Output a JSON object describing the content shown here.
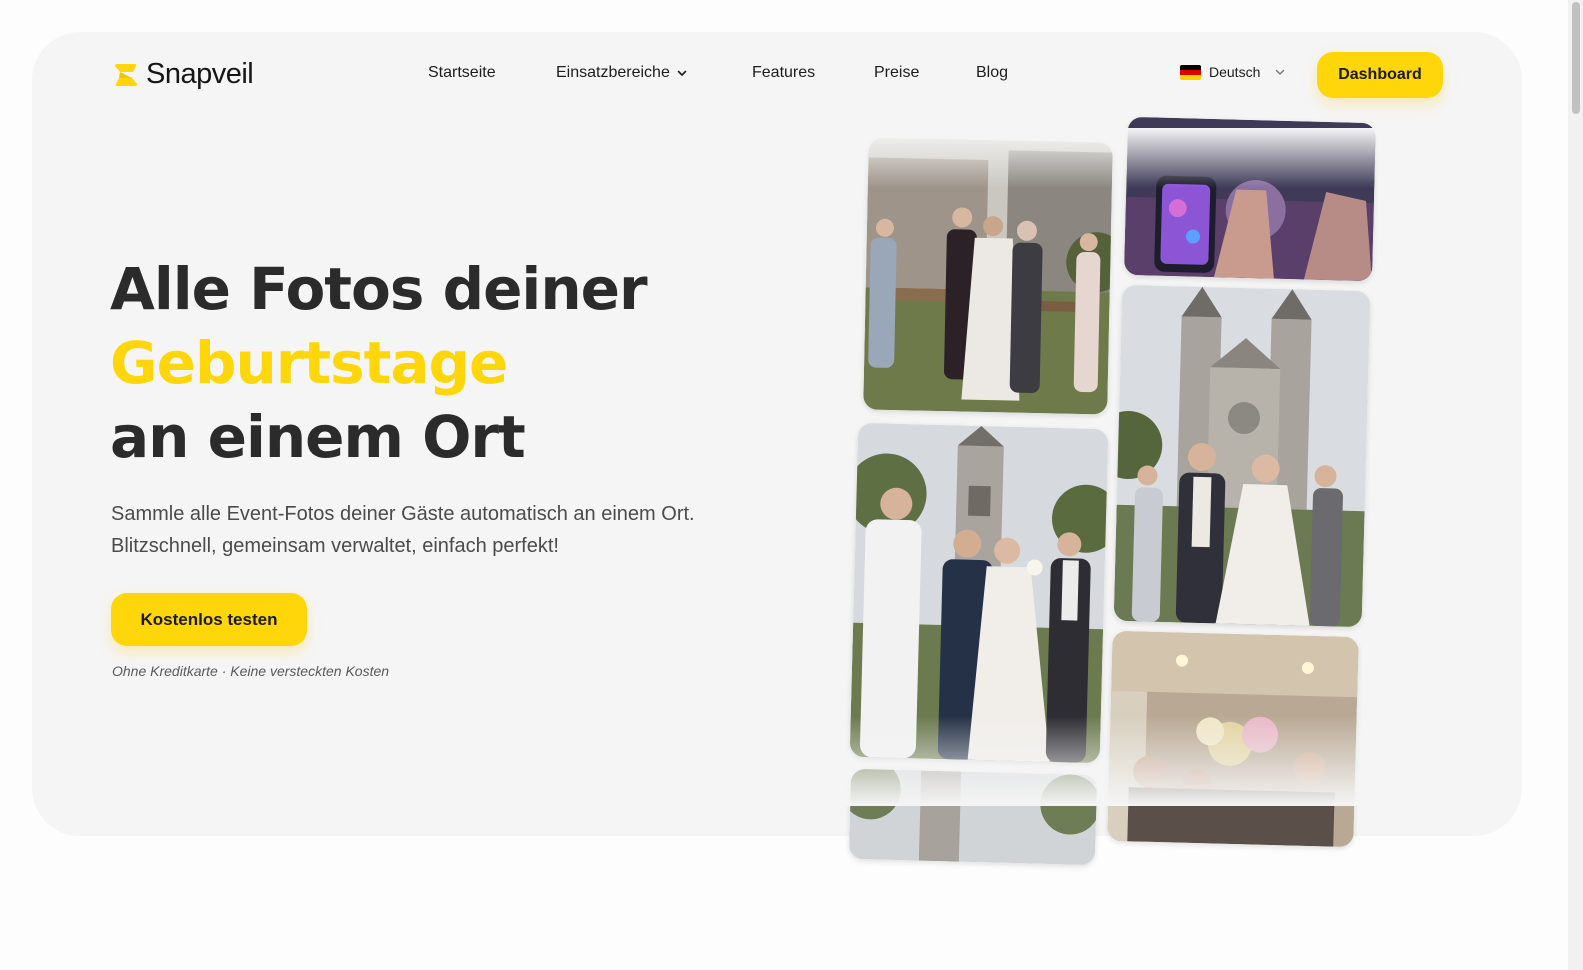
{
  "brand": {
    "name": "Snapveil",
    "color": "#ffd60a",
    "text_color": "#161616"
  },
  "nav": {
    "items": [
      {
        "label": "Startseite",
        "has_dropdown": false
      },
      {
        "label": "Einsatzbereiche",
        "has_dropdown": true
      },
      {
        "label": "Features",
        "has_dropdown": false
      },
      {
        "label": "Preise",
        "has_dropdown": false
      },
      {
        "label": "Blog",
        "has_dropdown": false
      }
    ],
    "language": {
      "label": "Deutsch",
      "flag_icon": "flag-de-icon"
    },
    "dashboard_label": "Dashboard"
  },
  "hero": {
    "headline_line1": "Alle Fotos deiner",
    "headline_accent": "Geburtstage",
    "headline_line3": "an einem Ort",
    "subtitle_line1": "Sammle alle Event-Fotos deiner Gäste automatisch an einem Ort.",
    "subtitle_line2": "Blitzschnell, gemeinsam verwaltet, einfach perfekt!",
    "cta_label": "Kostenlos testen",
    "note": "Ohne Kreditkarte · Keine versteckten Kosten"
  },
  "collage": {
    "photos": [
      {
        "name": "photo-wedding-group-garden",
        "subject": "wedding couple with guests in garden"
      },
      {
        "name": "photo-party-phone-hands",
        "subject": "hands holding phone at party"
      },
      {
        "name": "photo-wedding-church-couple",
        "subject": "laughing wedding couple in front of church"
      },
      {
        "name": "photo-wedding-church-guests",
        "subject": "bride greeting guests in front of church"
      },
      {
        "name": "photo-birthday-indoor-party",
        "subject": "indoor party with balloons"
      },
      {
        "name": "photo-church-partial",
        "subject": "church tower, partially visible"
      }
    ]
  },
  "colors": {
    "accent": "#ffd60a",
    "headline": "#2b2b2b",
    "body_text": "#4b4b4b",
    "hero_background": "#f5f5f5",
    "page_background": "#fdfdfd"
  }
}
